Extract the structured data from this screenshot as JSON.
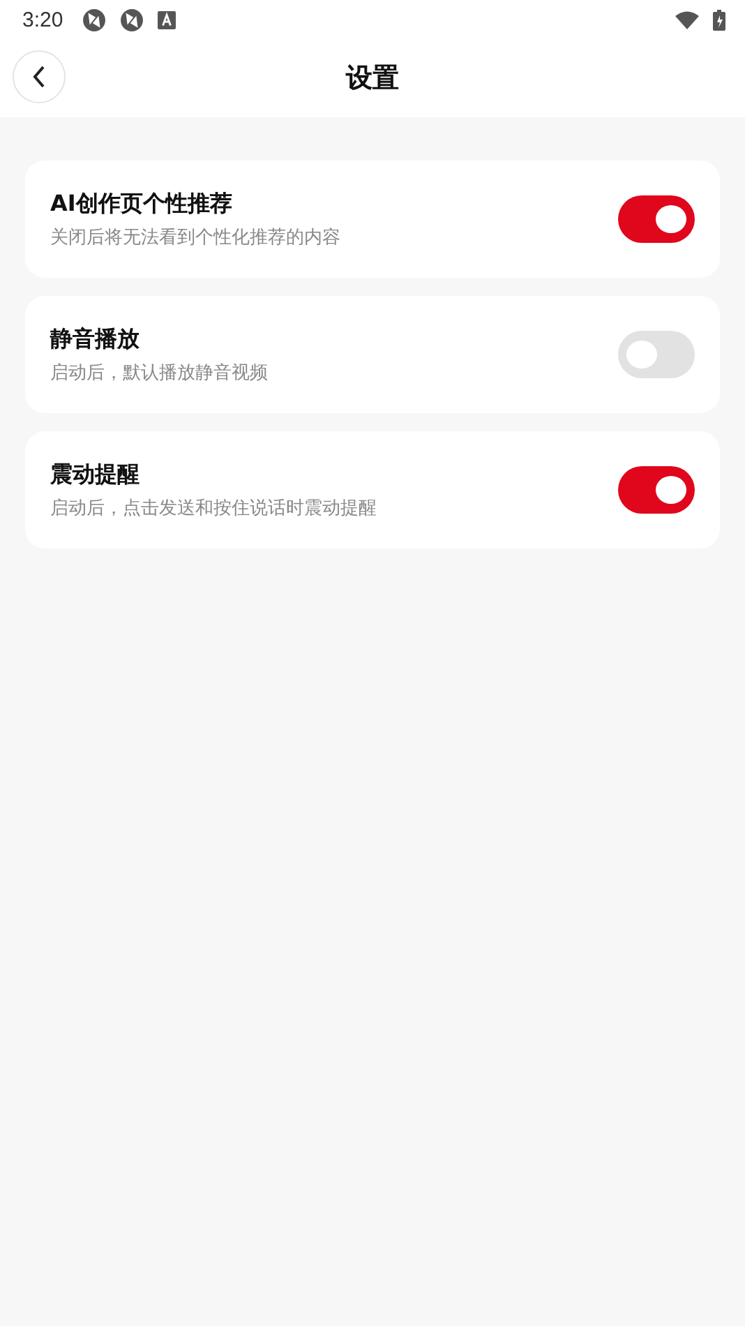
{
  "status_bar": {
    "time": "3:20"
  },
  "header": {
    "title": "设置"
  },
  "settings": [
    {
      "title": "AI创作页个性推荐",
      "description": "关闭后将无法看到个性化推荐的内容",
      "on": true
    },
    {
      "title": "静音播放",
      "description": "启动后，默认播放静音视频",
      "on": false
    },
    {
      "title": "震动提醒",
      "description": "启动后，点击发送和按住说话时震动提醒",
      "on": true
    }
  ]
}
